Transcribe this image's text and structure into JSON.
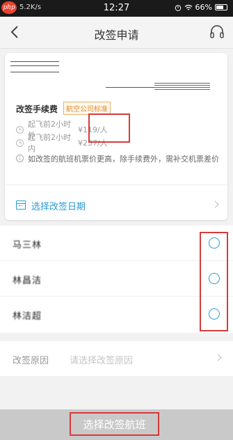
{
  "status_bar": {
    "logo_text": "php",
    "carrier": "5.2K/s",
    "time": "12:27",
    "battery": "66%"
  },
  "nav": {
    "title": "改签申请"
  },
  "fee": {
    "title": "改签手续费",
    "tag": "航空公司标准",
    "rows": [
      {
        "label": "起飞前2小时外",
        "price": "¥119/人"
      },
      {
        "label": "起飞前2小时内",
        "price": "¥237/人"
      }
    ]
  },
  "info": {
    "text": "如改签的航班机票价更高，除手续费外，需补交机票差价"
  },
  "date_selector": {
    "label": "选择改签日期"
  },
  "passengers": [
    {
      "name": "马三林"
    },
    {
      "name": "林昌洁"
    },
    {
      "name": "林洁超"
    }
  ],
  "reason": {
    "label": "改签原因",
    "placeholder": "请选择改签原因"
  },
  "bottom": {
    "button_label": "选择改签航班"
  },
  "colors": {
    "accent": "#2b9ad6",
    "highlight_border": "#d63a3a",
    "tag": "#e08a2e"
  }
}
